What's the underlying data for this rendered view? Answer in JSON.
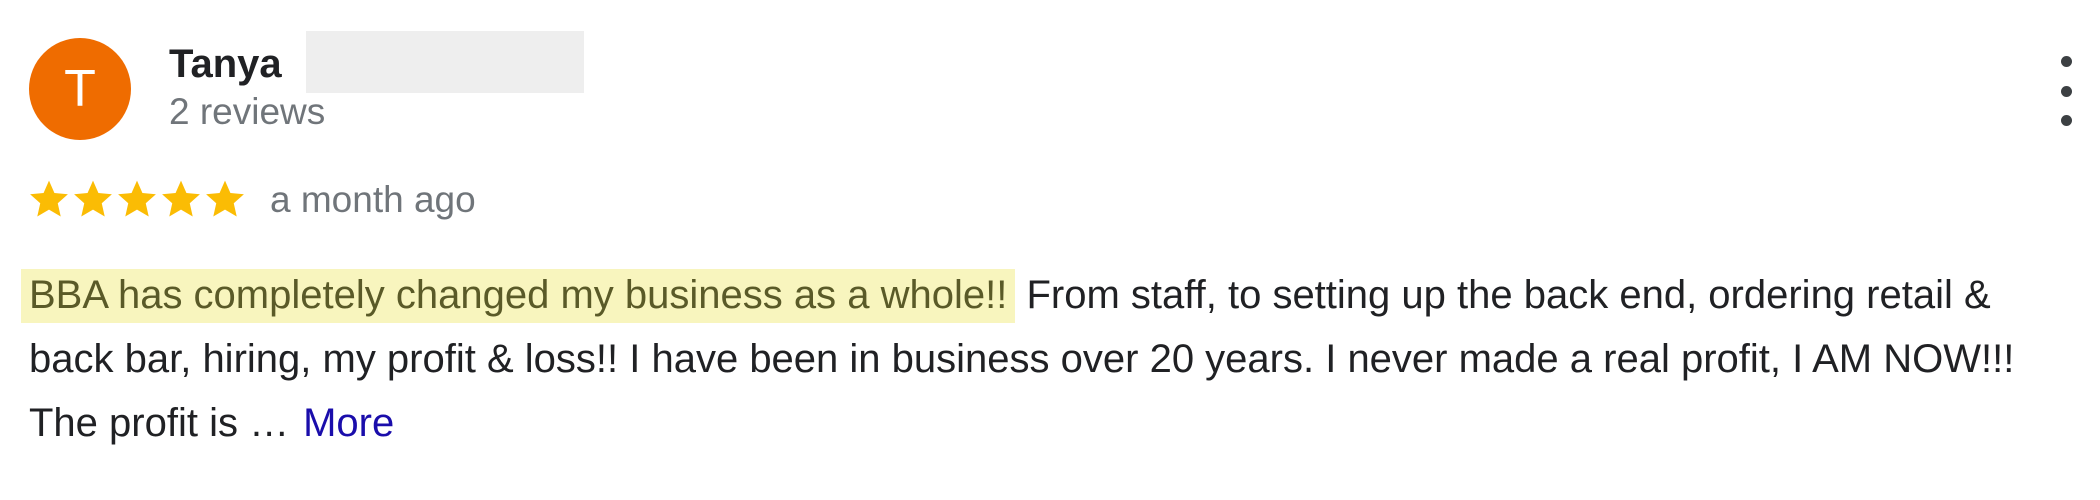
{
  "reviewer": {
    "initial": "T",
    "name": "Tanya",
    "review_count": "2 reviews",
    "avatar_color": "#ef6c00"
  },
  "review": {
    "rating": 5,
    "rating_max": 5,
    "date": "a month ago",
    "highlighted_text": "BBA has completely changed my business as a whole!!",
    "body_text": " From staff, to setting up the back end, ordering retail & back bar, hiring, my profit & loss!! I have been in business over 20 years. I never made a real profit, I AM NOW!!! The profit is …",
    "more_label": "More"
  },
  "icons": {
    "menu": "more-vertical-icon",
    "star": "star-icon"
  },
  "colors": {
    "star": "#fbbc04",
    "highlight_bg": "#f8f5be",
    "link": "#1a0dab"
  }
}
